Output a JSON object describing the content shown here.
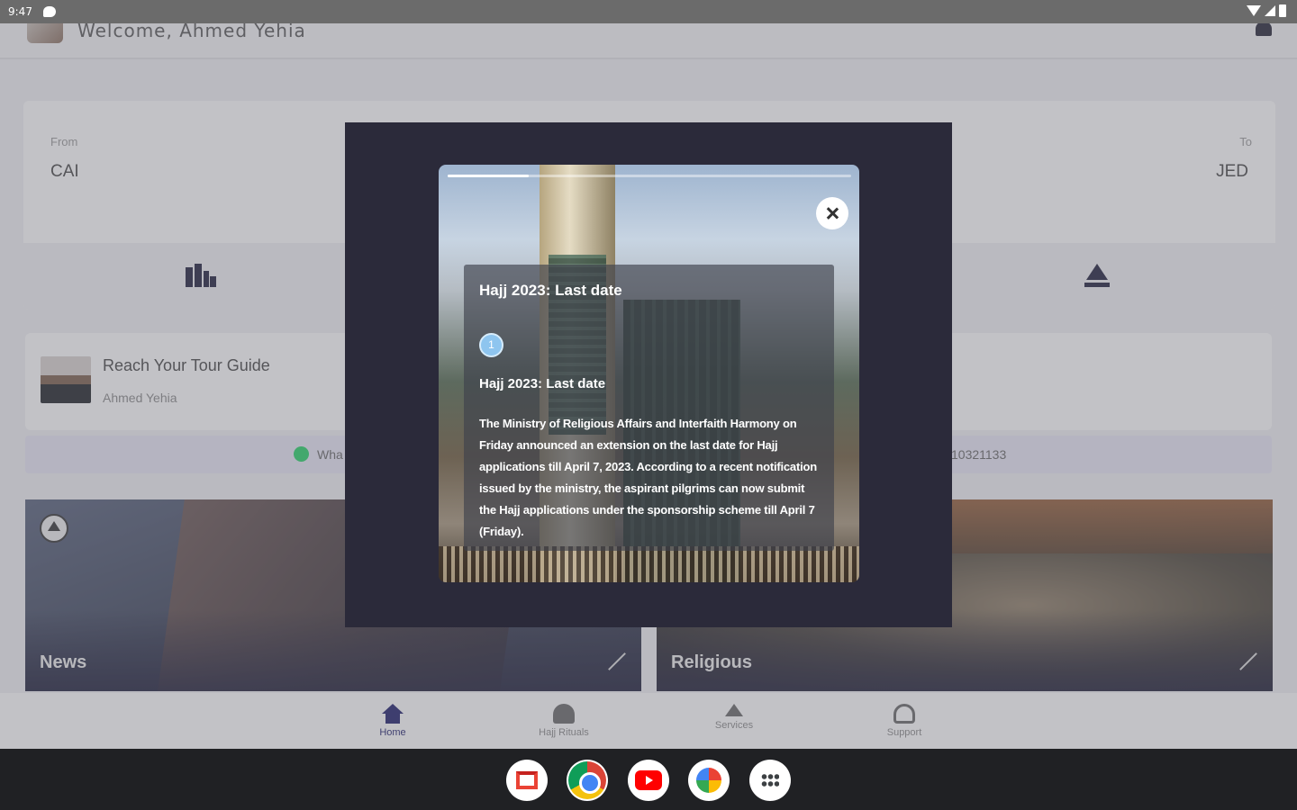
{
  "status_bar": {
    "time": "9:47"
  },
  "header": {
    "welcome": "Welcome, Ahmed Yehia"
  },
  "flight": {
    "from_label": "From",
    "from_code": "CAI",
    "to_label": "To",
    "to_code": "JED"
  },
  "guide": {
    "title": "Reach Your Tour Guide",
    "name": "Ahmed Yehia",
    "whatsapp_label": "Wha",
    "phone_partial": "10321133"
  },
  "tiles": [
    {
      "label": "News"
    },
    {
      "label": "Religious"
    }
  ],
  "bottom_nav": {
    "items": [
      {
        "label": "Home",
        "icon": "home-icon",
        "active": true
      },
      {
        "label": "Hajj Rituals",
        "icon": "kaaba-icon",
        "active": false
      },
      {
        "label": "Services",
        "icon": "services-icon",
        "active": false
      },
      {
        "label": "Support",
        "icon": "headset-icon",
        "active": false
      }
    ]
  },
  "dock": {
    "apps": [
      "gmail-icon",
      "chrome-icon",
      "youtube-icon",
      "photos-icon",
      "app-drawer-icon"
    ]
  },
  "story": {
    "progress": 0.2,
    "title": "Hajj 2023: Last date",
    "step": "1",
    "subtitle": "Hajj 2023: Last date",
    "body": "The Ministry of Religious Affairs and Interfaith Harmony on Friday announced an extension on the last date for Hajj applications till April 7, 2023. According to a recent notification issued by the ministry, the aspirant pilgrims can now submit the Hajj applications under the sponsorship scheme till April 7 (Friday)."
  },
  "colors": {
    "accent": "#1d1d6a",
    "modal_bg": "#2b2a3a",
    "whatsapp": "#25d366",
    "step_badge": "#8ec5ef"
  }
}
